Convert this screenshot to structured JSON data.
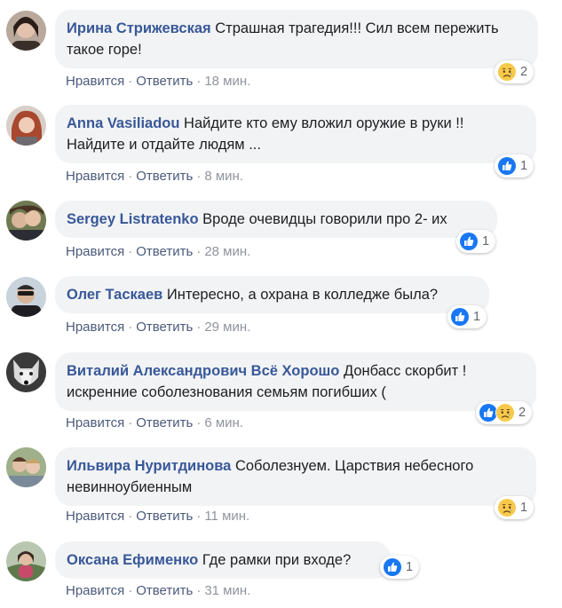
{
  "colors": {
    "author": "#385898",
    "bubble": "#f2f3f5",
    "meta": "#90949c",
    "like_blue": "#1877f2",
    "sad_yellow": "#f7c94b"
  },
  "actions": {
    "like_label": "Нравится",
    "reply_label": "Ответить",
    "separator": "·"
  },
  "comments": [
    {
      "author": "Ирина Стрижевская",
      "text": "Страшная трагедия!!! Сил всем пережить такое горе!",
      "time": "18 мин.",
      "reactions": [
        "sad-icon"
      ],
      "reaction_count": "2"
    },
    {
      "author": "Anna Vasiliadou",
      "text": "Найдите кто ему вложил оружие в руки !! Найдите и отдайте людям ...",
      "time": "8 мин.",
      "reactions": [
        "like-icon"
      ],
      "reaction_count": "1"
    },
    {
      "author": "Sergey Listratenko",
      "text": "Вроде очевидцы говорили про 2- их",
      "time": "28 мин.",
      "reactions": [
        "like-icon"
      ],
      "reaction_count": "1"
    },
    {
      "author": "Олег Таскаев",
      "text": "Интересно, а охрана в колледже была?",
      "time": "29 мин.",
      "reactions": [
        "like-icon"
      ],
      "reaction_count": "1"
    },
    {
      "author": "Виталий Александрович Всё Хорошо",
      "text": "Донбасс скорбит ! искренние соболезнования семьям погибших (",
      "time": "6 мин.",
      "reactions": [
        "like-icon",
        "sad-icon"
      ],
      "reaction_count": "2"
    },
    {
      "author": "Ильвира Нуритдинова",
      "text": "Соболезнуем. Царствия небесного невинноубиенным",
      "time": "11 мин.",
      "reactions": [
        "sad-icon"
      ],
      "reaction_count": "1"
    },
    {
      "author": "Оксана Ефименко",
      "text": "Где рамки при входе?",
      "time": "31 мин.",
      "reactions": [
        "like-icon"
      ],
      "reaction_count": "1"
    }
  ]
}
